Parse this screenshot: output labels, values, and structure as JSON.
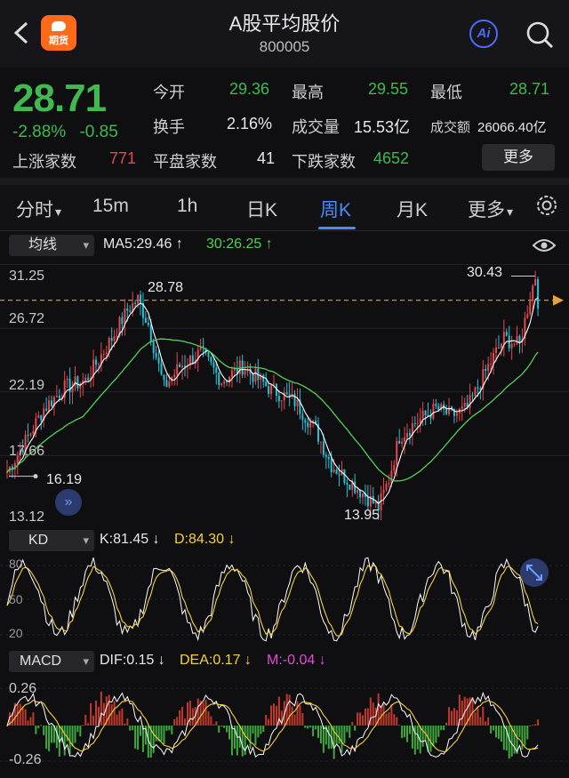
{
  "header": {
    "title": "A股平均股价",
    "code": "800005",
    "logo_text": "期货",
    "ai_label": "Ai"
  },
  "quote": {
    "price": "28.71",
    "change_pct": "-2.88%",
    "change_abs": "-0.85",
    "open_label": "今开",
    "open_value": "29.36",
    "high_label": "最高",
    "high_value": "29.55",
    "low_label": "最低",
    "low_value": "28.71",
    "turnover_label": "换手",
    "turnover_value": "2.16%",
    "volume_label": "成交量",
    "volume_value": "15.53亿",
    "amount_label": "成交额",
    "amount_value": "26066.40亿",
    "up_label": "上涨家数",
    "up_value": "771",
    "flat_label": "平盘家数",
    "flat_value": "41",
    "down_label": "下跌家数",
    "down_value": "4652",
    "more_label": "更多"
  },
  "tabs": [
    {
      "label": "分时",
      "caret": "▾"
    },
    {
      "label": "15m"
    },
    {
      "label": "1h"
    },
    {
      "label": "日K"
    },
    {
      "label": "周K",
      "active": true
    },
    {
      "label": "月K"
    },
    {
      "label": "更多",
      "caret": "▾"
    }
  ],
  "ma_bar": {
    "selector": "均线",
    "ma5": "MA5:29.46 ↑",
    "ma30": "30:26.25 ↑"
  },
  "main_chart": {
    "y_labels": [
      "31.25",
      "26.72",
      "22.19",
      "17.66",
      "13.12"
    ],
    "high_mark": "30.43",
    "peak_mark": "28.78",
    "low_mark": "13.95",
    "start_mark": "16.19"
  },
  "kd_bar": {
    "selector": "KD",
    "k": "K:81.45 ↓",
    "d": "D:84.30 ↓",
    "y_labels": [
      "80",
      "50",
      "20"
    ]
  },
  "macd_bar": {
    "selector": "MACD",
    "dif": "DIF:0.15 ↓",
    "dea": "DEA:0.17 ↓",
    "m": "M:-0.04 ↓",
    "y_labels": [
      "0.26",
      "-0.26"
    ]
  },
  "colors": {
    "up": "#e5484d",
    "down": "#3fb950",
    "accent": "#4a8cff",
    "ma5": "#ffffff",
    "ma30": "#55d055"
  },
  "icons": [
    "back-arrow-icon",
    "search-icon",
    "gear-icon",
    "eye-icon",
    "double-chevron-icon",
    "expand-icon"
  ]
}
